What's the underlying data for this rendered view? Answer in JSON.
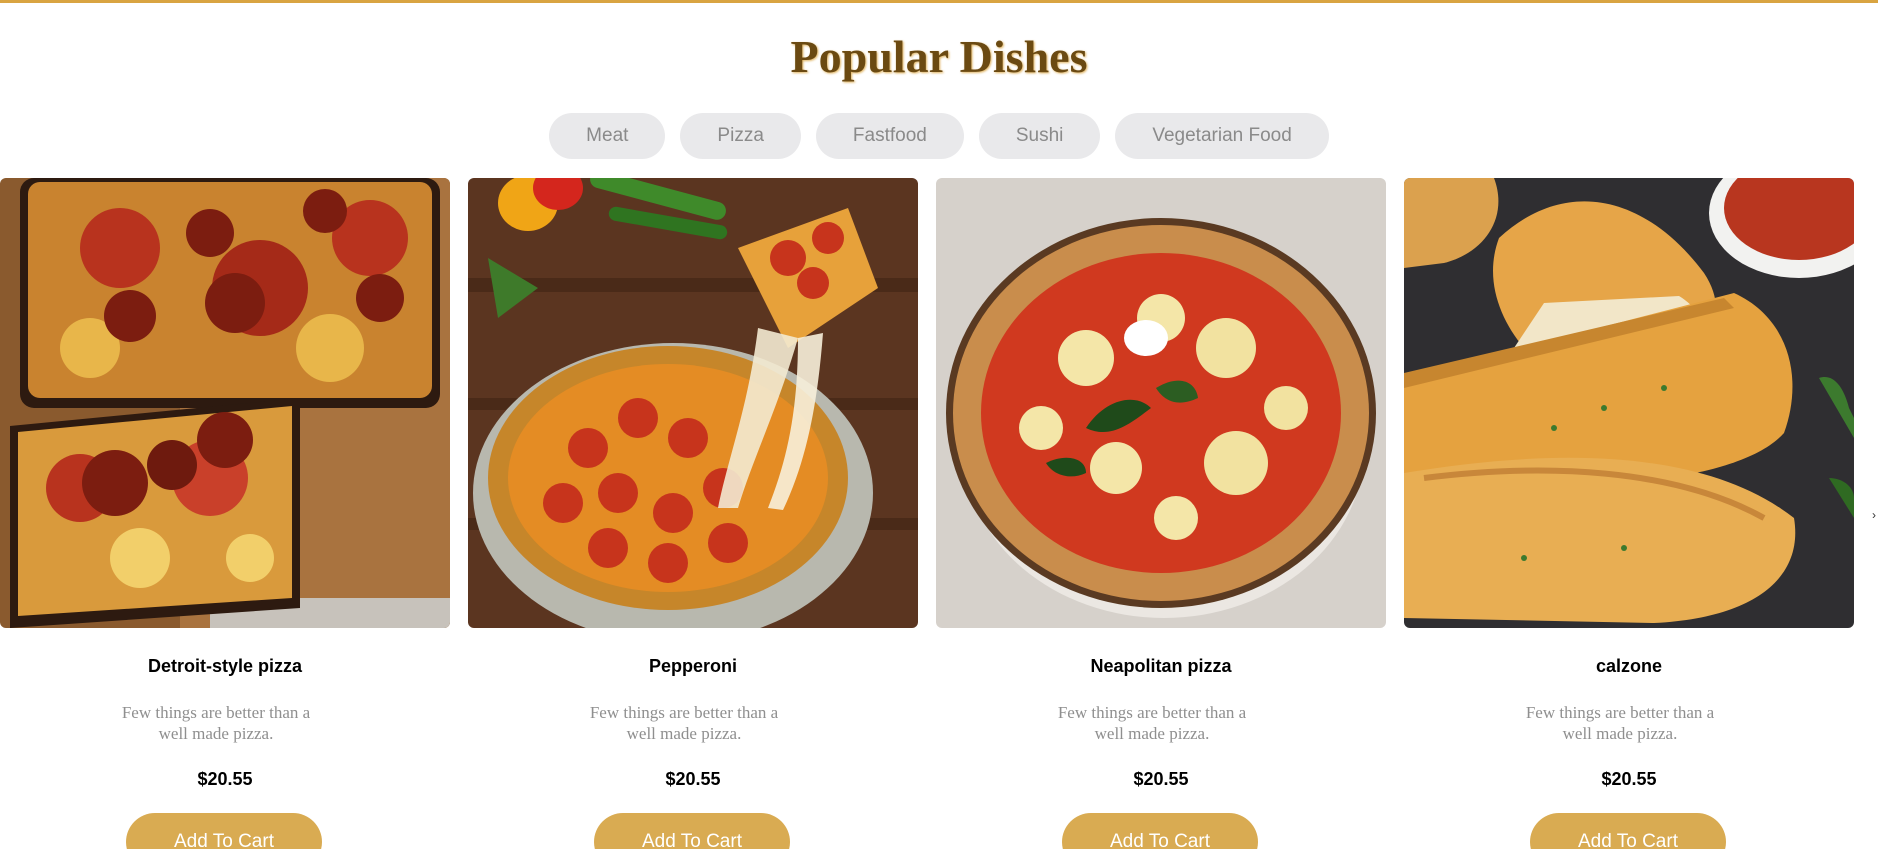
{
  "section": {
    "title": "Popular Dishes"
  },
  "tabs": [
    {
      "label": "Meat"
    },
    {
      "label": "Pizza"
    },
    {
      "label": "Fastfood"
    },
    {
      "label": "Sushi"
    },
    {
      "label": "Vegetarian Food"
    }
  ],
  "products": [
    {
      "name": "Detroit-style pizza",
      "description": "Few things are better than a well made pizza.",
      "price": "$20.55",
      "button": "Add To Cart"
    },
    {
      "name": "Pepperoni",
      "description": "Few things are better than a well made pizza.",
      "price": "$20.55",
      "button": "Add To Cart"
    },
    {
      "name": "Neapolitan pizza",
      "description": "Few things are better than a well made pizza.",
      "price": "$20.55",
      "button": "Add To Cart"
    },
    {
      "name": "calzone",
      "description": "Few things are better than a well made pizza.",
      "price": "$20.55",
      "button": "Add To Cart"
    }
  ],
  "colors": {
    "accent": "#d9ab52",
    "top_border": "#d9a441",
    "tab_bg": "#e9e9eb",
    "tab_text": "#8a8a8a",
    "title_text": "#6b4a12"
  }
}
